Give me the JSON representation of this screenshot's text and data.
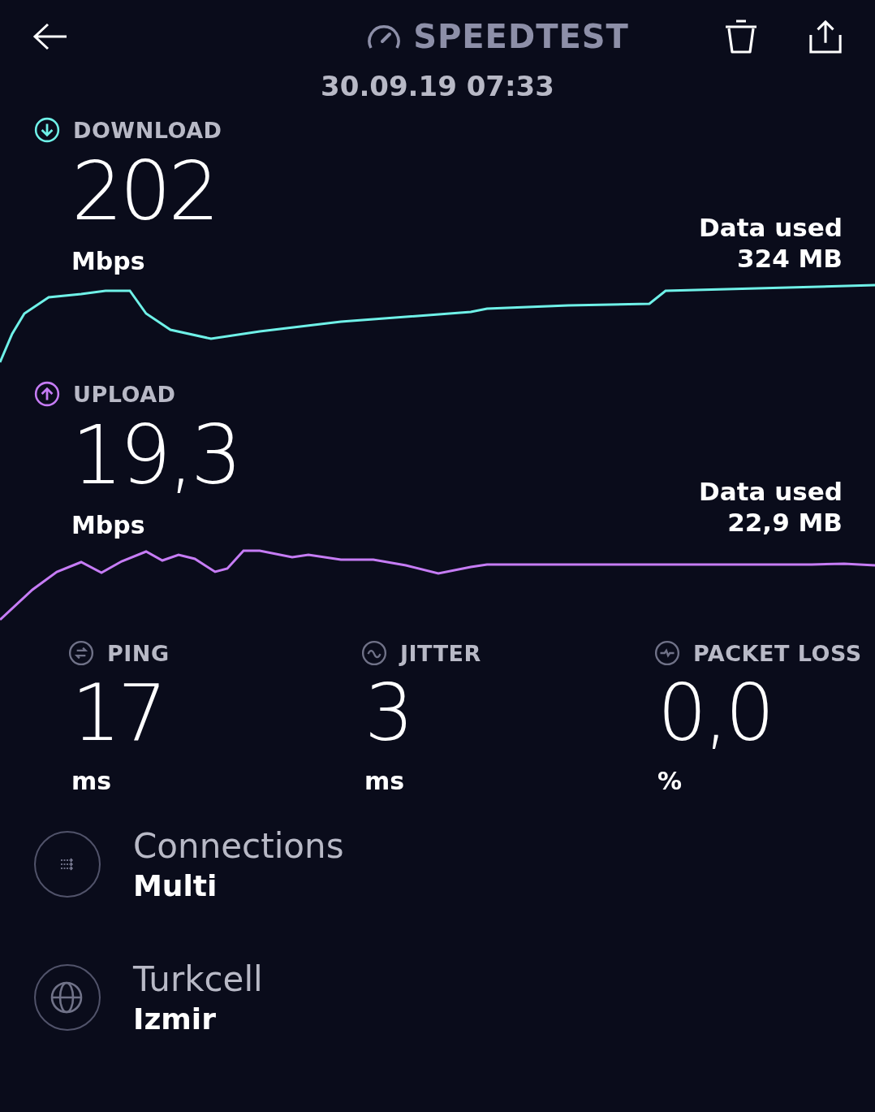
{
  "header": {
    "title": "SPEEDTEST",
    "date": "30.09.19 07:33"
  },
  "speeds": [
    {
      "kind": "download",
      "label": "DOWNLOAD",
      "value": "202",
      "unit": "Mbps",
      "data_label": "Data used",
      "data_value": "324 MB",
      "color": "#6ff1e8"
    },
    {
      "kind": "upload",
      "label": "UPLOAD",
      "value": "19,3",
      "unit": "Mbps",
      "data_label": "Data used",
      "data_value": "22,9 MB",
      "color": "#c67cf5"
    }
  ],
  "metrics": [
    {
      "kind": "ping",
      "label": "PING",
      "value": "17",
      "unit": "ms"
    },
    {
      "kind": "jitter",
      "label": "JITTER",
      "value": "3",
      "unit": "ms"
    },
    {
      "kind": "packet_loss",
      "label": "PACKET LOSS",
      "value": "0,0",
      "unit": "%"
    }
  ],
  "details": [
    {
      "kind": "connections",
      "title": "Connections",
      "value": "Multi"
    },
    {
      "kind": "provider",
      "title": "Turkcell",
      "value": "Izmir"
    }
  ]
}
